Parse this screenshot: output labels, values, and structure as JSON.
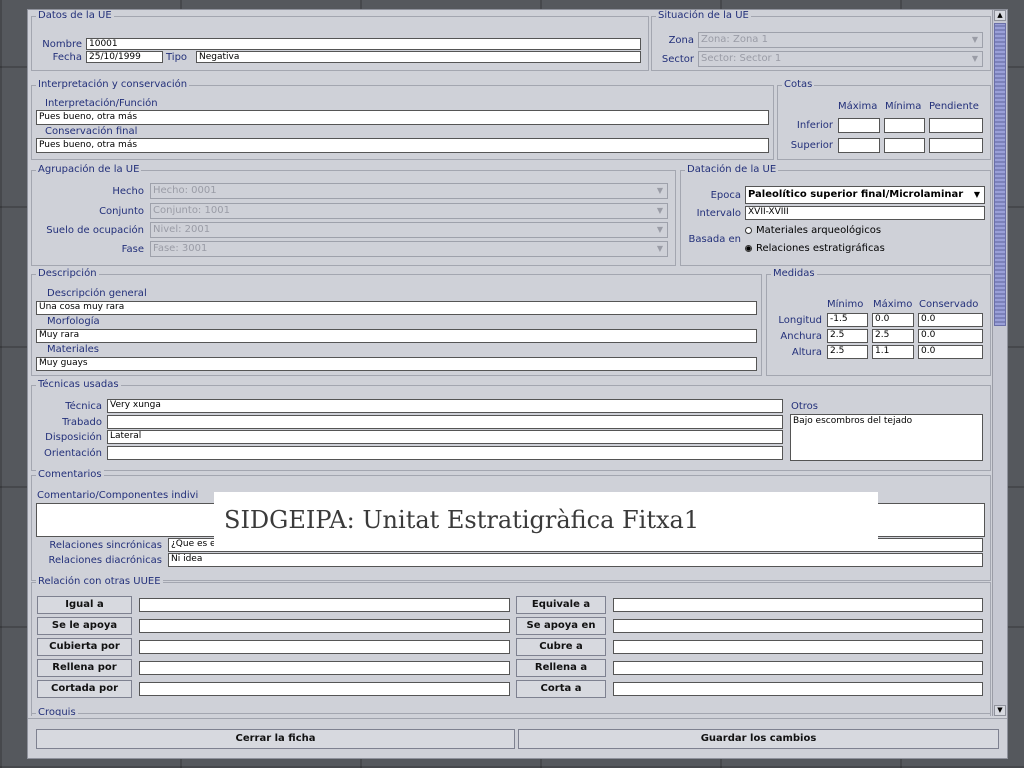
{
  "datos": {
    "title": "Datos de la UE",
    "nombre_label": "Nombre",
    "nombre": "10001",
    "fecha_label": "Fecha",
    "fecha": "25/10/1999",
    "tipo_label": "Tipo",
    "tipo": "Negativa"
  },
  "situacion": {
    "title": "Situación de la UE",
    "zona_label": "Zona",
    "zona": "Zona: Zona 1",
    "sector_label": "Sector",
    "sector": "Sector: Sector 1"
  },
  "interpretacion": {
    "title": "Interpretación y conservación",
    "funcion_label": "Interpretación/Función",
    "funcion": "Pues bueno, otra más",
    "conservacion_label": "Conservación final",
    "conservacion": "Pues bueno, otra más"
  },
  "cotas": {
    "title": "Cotas",
    "col_maxima": "Máxima",
    "col_minima": "Mínima",
    "col_pendiente": "Pendiente",
    "row_inferior": "Inferior",
    "row_superior": "Superior"
  },
  "agrupacion": {
    "title": "Agrupación de la UE",
    "hecho_label": "Hecho",
    "hecho": "Hecho: 0001",
    "conjunto_label": "Conjunto",
    "conjunto": "Conjunto: 1001",
    "suelo_label": "Suelo de ocupación",
    "suelo": "Nivel: 2001",
    "fase_label": "Fase",
    "fase": "Fase: 3001"
  },
  "datacion": {
    "title": "Datación de la UE",
    "epoca_label": "Epoca",
    "epoca": "Paleolítico superior final/Microlaminar",
    "intervalo_label": "Intervalo",
    "intervalo": "XVII-XVIII",
    "basada_label": "Basada en",
    "radio1": "Materiales arqueológicos",
    "radio2": "Relaciones estratigráficas"
  },
  "descripcion": {
    "title": "Descripción",
    "general_label": "Descripción general",
    "general": "Una cosa muy rara",
    "morfologia_label": "Morfología",
    "morfologia": "Muy rara",
    "materiales_label": "Materiales",
    "materiales": "Muy guays"
  },
  "medidas": {
    "title": "Medidas",
    "col_minimo": "Mínimo",
    "col_maximo": "Máximo",
    "col_conservado": "Conservado",
    "rows": [
      {
        "label": "Longitud",
        "min": "-1.5",
        "max": "0.0",
        "cons": "0.0"
      },
      {
        "label": "Anchura",
        "min": "2.5",
        "max": "2.5",
        "cons": "0.0"
      },
      {
        "label": "Altura",
        "min": "2.5",
        "max": "1.1",
        "cons": "0.0"
      }
    ]
  },
  "tecnicas": {
    "title": "Técnicas usadas",
    "tecnica_label": "Técnica",
    "tecnica": "Very xunga",
    "trabado_label": "Trabado",
    "disposicion_label": "Disposición",
    "disposicion": "Lateral",
    "orientacion_label": "Orientación",
    "otros_label": "Otros",
    "otros": "Bajo escombros del tejado"
  },
  "comentarios": {
    "title": "Comentarios",
    "componentes_label": "Comentario/Componentes indivi",
    "sincronicas_label": "Relaciones sincrónicas",
    "sincronicas": "¿Que es eso?",
    "diacronicas_label": "Relaciones diacrónicas",
    "diacronicas": "Ni idea"
  },
  "relacion": {
    "title": "Relación con otras UUEE",
    "left": [
      "Igual a",
      "Se le apoya",
      "Cubierta por",
      "Rellena por",
      "Cortada por"
    ],
    "right": [
      "Equivale a",
      "Se apoya en",
      "Cubre a",
      "Rellena a",
      "Corta a"
    ]
  },
  "croquis": {
    "title": "Croquis"
  },
  "footer": {
    "cerrar": "Cerrar la ficha",
    "guardar": "Guardar los cambios"
  },
  "overlay_title": "SIDGEIPA: Unitat Estratigràfica Fitxa1"
}
